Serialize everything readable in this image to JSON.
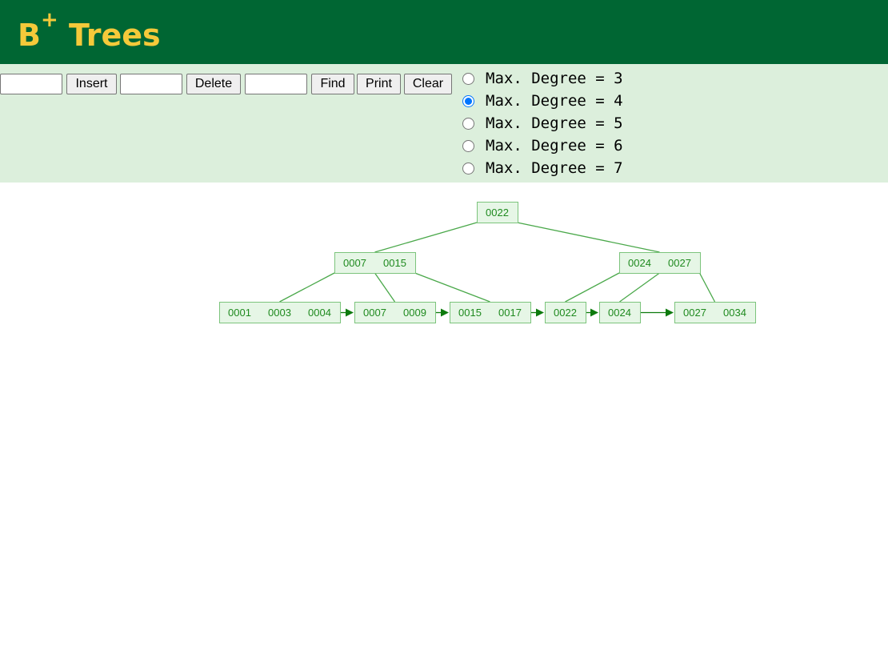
{
  "header": {
    "title_main": "B",
    "title_sup": "+",
    "title_rest": " Trees",
    "background": "#006633",
    "title_color": "#f5c93a"
  },
  "controls": {
    "background": "#dcefdc",
    "insert_value": "",
    "insert_label": "Insert",
    "delete_value": "",
    "delete_label": "Delete",
    "find_value": "",
    "find_label": "Find",
    "print_label": "Print",
    "clear_label": "Clear",
    "degree_options": [
      {
        "label": "Max. Degree = 3",
        "value": 3,
        "checked": false
      },
      {
        "label": "Max. Degree = 4",
        "value": 4,
        "checked": true
      },
      {
        "label": "Max. Degree = 5",
        "value": 5,
        "checked": false
      },
      {
        "label": "Max. Degree = 6",
        "value": 6,
        "checked": false
      },
      {
        "label": "Max. Degree = 7",
        "value": 7,
        "checked": false
      }
    ]
  },
  "tree": {
    "levels": [
      [
        {
          "keys": [
            "0022"
          ]
        }
      ],
      [
        {
          "keys": [
            "0007",
            "0015"
          ]
        },
        {
          "keys": [
            "0024",
            "0027"
          ]
        }
      ],
      [
        {
          "keys": [
            "0001",
            "0003",
            "0004"
          ]
        },
        {
          "keys": [
            "0007",
            "0009"
          ]
        },
        {
          "keys": [
            "0015",
            "0017"
          ]
        },
        {
          "keys": [
            "0022"
          ]
        },
        {
          "keys": [
            "0024"
          ]
        },
        {
          "keys": [
            "0027",
            "0034"
          ]
        }
      ]
    ],
    "colors": {
      "node_fill": "#e6f6e6",
      "node_stroke": "#7cc47c",
      "key_text": "#1f8a1f",
      "edge": "#4aa84a",
      "leaf_link": "#0d7a0d"
    }
  }
}
